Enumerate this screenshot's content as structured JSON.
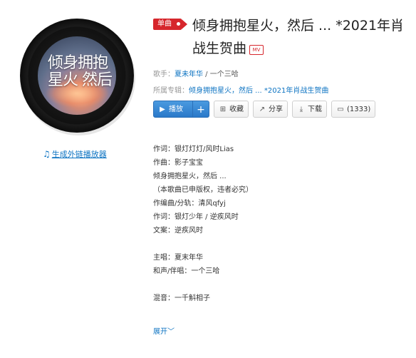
{
  "cover": {
    "text": "倾身拥抱星火 然后"
  },
  "external_link": "生成外链播放器",
  "badge": "单曲",
  "title": "倾身拥抱星火，然后 ... *2021年肖战生贺曲",
  "mv_label": "MV",
  "singer": {
    "label": "歌手：",
    "name1": "夏未年华",
    "sep": " / ",
    "name2": "一个三哈"
  },
  "album": {
    "label": "所属专辑：",
    "name": "倾身拥抱星火，然后 ... *2021年肖战生贺曲"
  },
  "buttons": {
    "play": "播放",
    "add": "+",
    "collect": "收藏",
    "share": "分享",
    "download": "下载",
    "comment": "(1333)"
  },
  "icons": {
    "play": "play-circle-icon",
    "collect": "folder-plus-icon",
    "share": "share-icon",
    "download": "download-icon",
    "comment": "comment-icon",
    "note": "music-note-icon"
  },
  "lyrics": [
    "作词：银灯灯灯/风时Lias",
    "作曲：影子宝宝",
    "倾身拥抱星火，然后 ...",
    "（本歌曲已申版权，违者必究）",
    "作编曲/分轨：清风qfyj",
    "作词：银灯少年 / 逆疾风时",
    "文案：逆疾风时",
    "",
    "主唱：夏末年华",
    "和声/伴唱：一个三哈",
    "",
    "混音：一千斛相子"
  ],
  "expand": "展开",
  "colors": {
    "accent": "#d6262c",
    "link": "#0c73c2",
    "play": "#2a79c9"
  }
}
